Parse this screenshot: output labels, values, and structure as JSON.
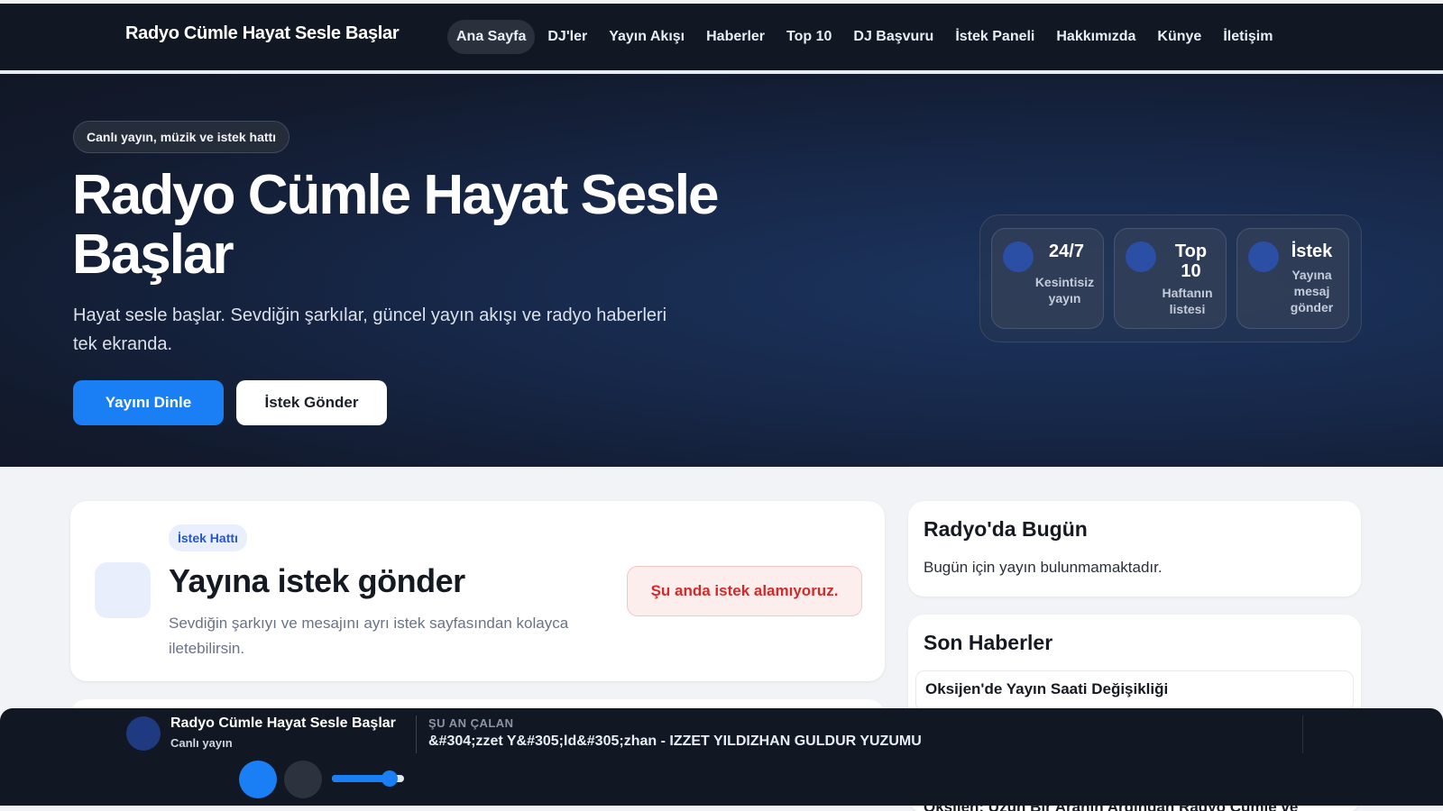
{
  "header": {
    "brand": "Radyo Cümle Hayat Sesle Başlar",
    "nav": [
      {
        "label": "Ana Sayfa",
        "active": true
      },
      {
        "label": "DJ'ler"
      },
      {
        "label": "Yayın Akışı"
      },
      {
        "label": "Haberler"
      },
      {
        "label": "Top 10"
      },
      {
        "label": "DJ Başvuru"
      },
      {
        "label": "İstek Paneli"
      },
      {
        "label": "Hakkımızda"
      },
      {
        "label": "Künye"
      },
      {
        "label": "İletişim"
      }
    ]
  },
  "hero": {
    "pill": "Canlı yayın, müzik ve istek hattı",
    "title": "Radyo Cümle Hayat Sesle Başlar",
    "subtitle": "Hayat sesle başlar. Sevdiğin şarkılar, güncel yayın akışı ve radyo haberleri tek ekranda.",
    "primary_button": "Yayını Dinle",
    "secondary_button": "İstek Gönder",
    "stats": [
      {
        "value": "24/7",
        "label": "Kesintisiz yayın"
      },
      {
        "value": "Top 10",
        "label": "Haftanın listesi"
      },
      {
        "value": "İstek",
        "label": "Yayına mesaj gönder"
      }
    ]
  },
  "request": {
    "badge": "İstek Hattı",
    "title": "Yayına istek gönder",
    "description": "Sevdiğin şarkıyı ve mesajını ayrı istek sayfasından kolayca iletebilirsin.",
    "alert": "Şu anda istek alamıyoruz."
  },
  "today": {
    "title": "Radyo'da Bugün",
    "text": "Bugün için yayın bulunmamaktadır."
  },
  "news": {
    "title": "Son Haberler",
    "items": [
      "Oksijen'de Yayın Saati Değişikliği",
      "Oksijen: Uzun Bir Aranın Ardından Radyo Cümle ve"
    ]
  },
  "player": {
    "station": "Radyo Cümle Hayat Sesle Başlar",
    "status": "Canlı yayın",
    "now_playing_label": "ŞU AN ÇALAN",
    "now_playing": "&#304;zzet Y&#305;ld&#305;zhan - IZZET YILDIZHAN GULDUR YUZUMU",
    "volume": 0.8
  },
  "colors": {
    "accent": "#1a7ef4",
    "dark": "#121823",
    "alert_text": "#d22a2a"
  }
}
